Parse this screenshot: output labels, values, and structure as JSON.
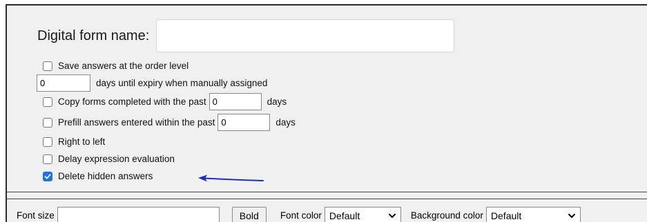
{
  "form": {
    "name_label": "Digital form name:",
    "name_value": ""
  },
  "options": {
    "save_answers_order_level": {
      "label": "Save answers at the order level",
      "checked": false
    },
    "expiry": {
      "value": "0",
      "label": "days until expiry when manually assigned"
    },
    "copy_forms": {
      "label": "Copy forms completed with the past",
      "value": "0",
      "suffix": "days",
      "checked": false
    },
    "prefill": {
      "label": "Prefill answers entered within the past",
      "value": "0",
      "suffix": "days",
      "checked": false
    },
    "right_to_left": {
      "label": "Right to left",
      "checked": false
    },
    "delay_expression": {
      "label": "Delay expression evaluation",
      "checked": false
    },
    "delete_hidden": {
      "label": "Delete hidden answers",
      "checked": true
    }
  },
  "toolbar": {
    "font_size_label": "Font size",
    "font_size_value": "",
    "bold_label": "Bold",
    "font_color_label": "Font color",
    "font_color_value": "Default",
    "background_color_label": "Background color",
    "background_color_value": "Default"
  },
  "colors": {
    "panel_bg": "#f0f0f0",
    "checkbox_checked": "#1a73e8",
    "annotation_arrow": "#1c2fc2"
  }
}
